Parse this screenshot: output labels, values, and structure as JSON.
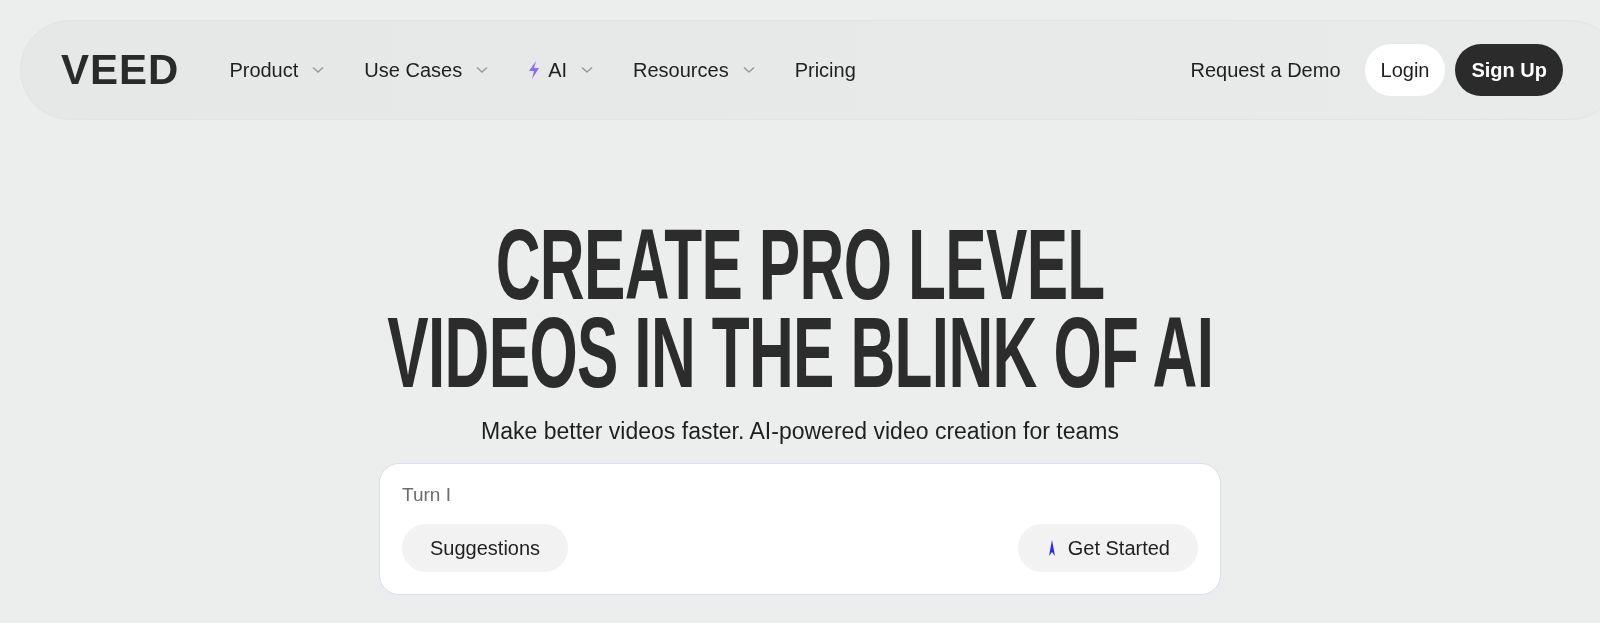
{
  "logo": "VEED",
  "nav": [
    {
      "label": "Product",
      "kind": "menu"
    },
    {
      "label": "Use Cases",
      "kind": "menu"
    },
    {
      "label": "AI",
      "kind": "featured"
    },
    {
      "label": "Resources",
      "kind": "menu"
    },
    {
      "label": "Pricing",
      "kind": "link"
    }
  ],
  "actions": {
    "demo": "Request a Demo",
    "login": "Login",
    "signup": "Sign Up"
  },
  "headline": [
    "CREATE PRO LEVEL",
    "VIDEOS IN THE BLINK OF AI"
  ],
  "subtitle": "Make better videos faster. AI-powered video creation for teams",
  "prompt": {
    "value": "Turn I",
    "suggestions": "Suggestions",
    "start": "Get Started"
  }
}
